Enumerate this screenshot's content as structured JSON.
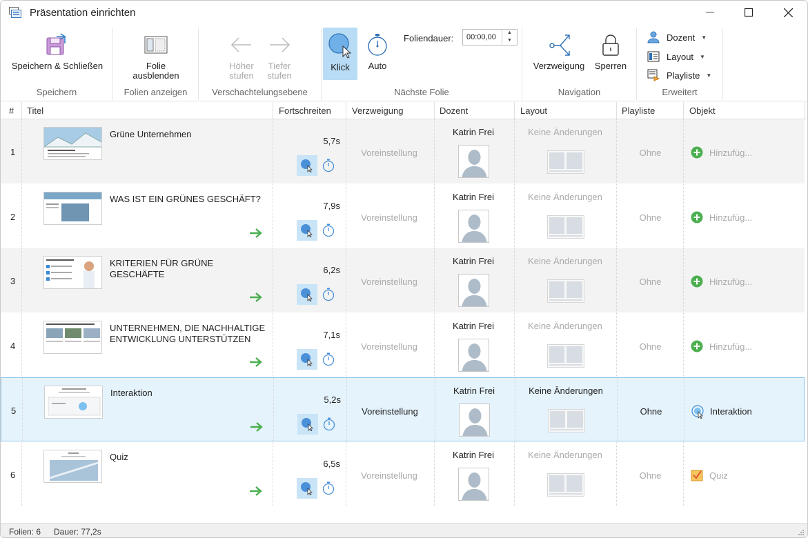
{
  "window": {
    "title": "Präsentation einrichten"
  },
  "ribbon": {
    "groups": {
      "speichern": "Speichern",
      "folien_anzeigen": "Folien anzeigen",
      "verschachtelung": "Verschachtelungsebene",
      "naechste_folie": "Nächste Folie",
      "navigation": "Navigation",
      "erweitert": "Erweitert"
    },
    "buttons": {
      "save_close": "Speichern & Schließen",
      "hide_slide_1": "Folie",
      "hide_slide_2": "ausblenden",
      "promote_1": "Höher",
      "promote_2": "stufen",
      "demote_1": "Tiefer",
      "demote_2": "stufen",
      "klick": "Klick",
      "auto": "Auto",
      "verzweigung": "Verzweigung",
      "sperren": "Sperren",
      "dozent": "Dozent",
      "layout": "Layout",
      "playliste": "Playliste"
    },
    "foliendauer": {
      "label": "Foliendauer:",
      "value": "00:00,00"
    }
  },
  "table": {
    "headers": {
      "num": "#",
      "titel": "Titel",
      "fortschreiten": "Fortschreiten",
      "verzweigung": "Verzweigung",
      "dozent": "Dozent",
      "layout": "Layout",
      "playliste": "Playliste",
      "objekt": "Objekt"
    },
    "rows": [
      {
        "num": "1",
        "title": "Grüne Unternehmen",
        "duration": "5,7s",
        "branch": "Voreinstellung",
        "presenter": "Katrin Frei",
        "layout": "Keine Änderungen",
        "playlist": "Ohne",
        "object": "Hinzufüg..."
      },
      {
        "num": "2",
        "title": "WAS IST EIN GRÜNES GESCHÄFT?",
        "duration": "7,9s",
        "branch": "Voreinstellung",
        "presenter": "Katrin Frei",
        "layout": "Keine Änderungen",
        "playlist": "Ohne",
        "object": "Hinzufüg..."
      },
      {
        "num": "3",
        "title": "KRITERIEN FÜR GRÜNE GESCHÄFTE",
        "duration": "6,2s",
        "branch": "Voreinstellung",
        "presenter": "Katrin Frei",
        "layout": "Keine Änderungen",
        "playlist": "Ohne",
        "object": "Hinzufüg..."
      },
      {
        "num": "4",
        "title": "UNTERNEHMEN, DIE NACHHALTIGE ENTWICKLUNG UNTERSTÜTZEN",
        "duration": "7,1s",
        "branch": "Voreinstellung",
        "presenter": "Katrin Frei",
        "layout": "Keine Änderungen",
        "playlist": "Ohne",
        "object": "Hinzufüg..."
      },
      {
        "num": "5",
        "title": "Interaktion",
        "duration": "5,2s",
        "branch": "Voreinstellung",
        "presenter": "Katrin Frei",
        "layout": "Keine Änderungen",
        "playlist": "Ohne",
        "object": "Interaktion"
      },
      {
        "num": "6",
        "title": "Quiz",
        "duration": "6,5s",
        "branch": "Voreinstellung",
        "presenter": "Katrin Frei",
        "layout": "Keine Änderungen",
        "playlist": "Ohne",
        "object": "Quiz"
      }
    ]
  },
  "status": {
    "folien": "Folien: 6",
    "dauer": "Dauer: 77,2s"
  },
  "colors": {
    "accent": "#4a90d9",
    "selection": "#e5f3fc",
    "green_arrow": "#4caf50"
  }
}
